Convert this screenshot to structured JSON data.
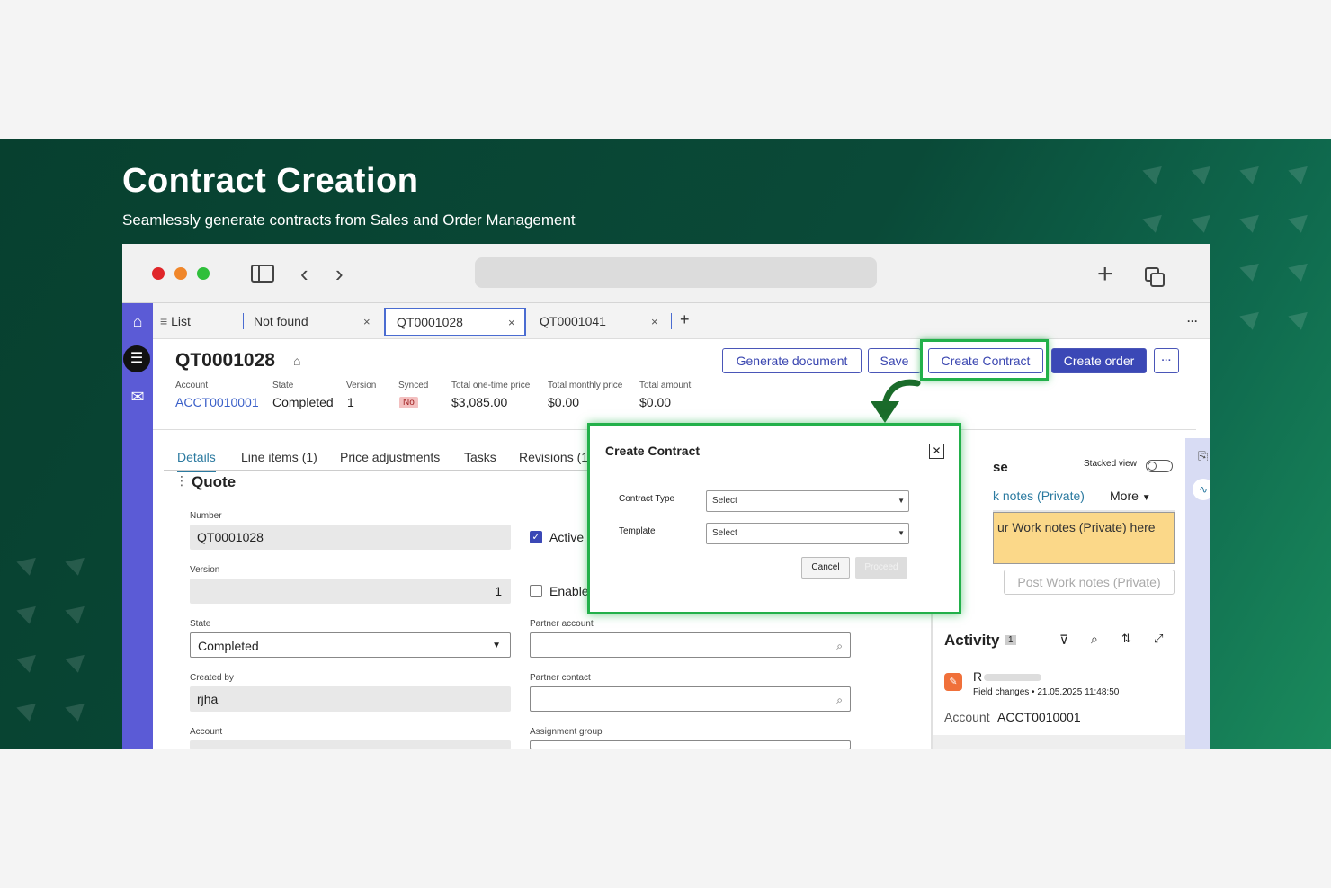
{
  "hero": {
    "title": "Contract Creation",
    "subtitle": "Seamlessly generate contracts from Sales and Order Management"
  },
  "tabs": {
    "list": "List",
    "tab1": "Not found",
    "tab2": "QT0001028",
    "tab3": "QT0001041",
    "close": "×",
    "add": "+",
    "more": "···"
  },
  "record": {
    "title": "QT0001028",
    "account_label": "Account",
    "account_value": "ACCT0010001",
    "state_label": "State",
    "state_value": "Completed",
    "version_label": "Version",
    "version_value": "1",
    "synced_label": "Synced",
    "synced_value": "No",
    "onetime_label": "Total one-time price",
    "onetime_value": "$3,085.00",
    "monthly_label": "Total monthly price",
    "monthly_value": "$0.00",
    "total_label": "Total amount",
    "total_value": "$0.00"
  },
  "actions": {
    "generate": "Generate document",
    "save": "Save",
    "create_contract": "Create Contract",
    "create_order": "Create order",
    "more": "···"
  },
  "form_tabs": [
    "Details",
    "Line items (1)",
    "Price adjustments",
    "Tasks",
    "Revisions (1)"
  ],
  "form": {
    "section": "Quote",
    "number_label": "Number",
    "number_value": "QT0001028",
    "active_label": "Active",
    "version_label": "Version",
    "version_value": "1",
    "enable_label": "Enable",
    "state_label": "State",
    "state_value": "Completed",
    "partner_account_label": "Partner account",
    "created_by_label": "Created by",
    "created_by_value": "rjha",
    "partner_contact_label": "Partner contact",
    "account_label": "Account",
    "assignment_group_label": "Assignment group"
  },
  "panel": {
    "title_fragment": "se",
    "stacked_view": "Stacked view",
    "notes_tab": "k notes (Private)",
    "more_tab": "More",
    "notes_placeholder": "ur Work notes (Private) here",
    "post_button": "Post Work notes (Private)",
    "activity_title": "Activity",
    "activity_count": "1",
    "entry_initial": "R",
    "entry_meta": "Field changes • 21.05.2025 11:48:50",
    "entry_field": "Account",
    "entry_value": "ACCT0010001"
  },
  "modal": {
    "title": "Create Contract",
    "contract_type_label": "Contract Type",
    "contract_type_value": "Select",
    "template_label": "Template",
    "template_value": "Select",
    "cancel": "Cancel",
    "proceed": "Proceed"
  },
  "colors": {
    "banner": "#07402f",
    "accent": "#3b48b6",
    "highlight": "#22b04a",
    "sidenav": "#5b5bd6"
  }
}
